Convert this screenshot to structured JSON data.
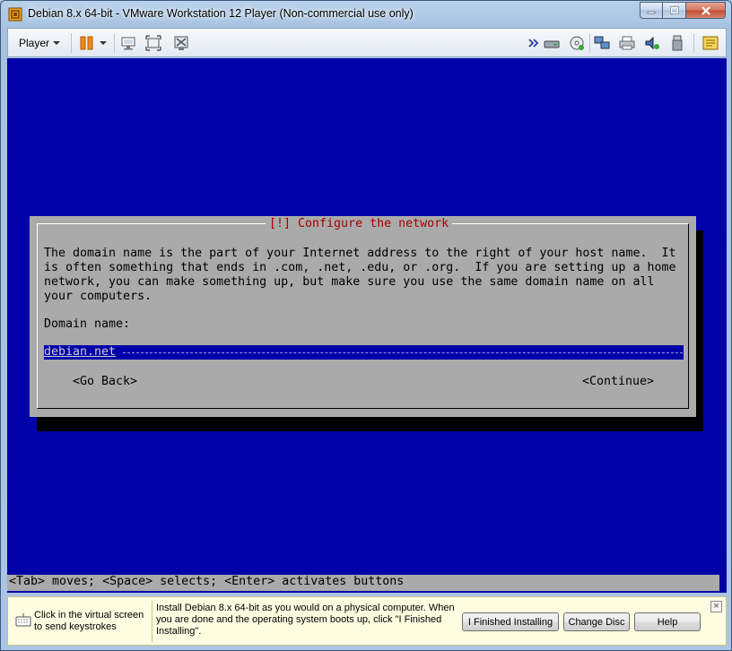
{
  "window": {
    "title": "Debian 8.x 64-bit - VMware Workstation 12 Player (Non-commercial use only)"
  },
  "toolbar": {
    "player_label": "Player"
  },
  "installer": {
    "dialog_title": "[!] Configure the network",
    "body_text": "The domain name is the part of your Internet address to the right of your host name.  It\nis often something that ends in .com, .net, .edu, or .org.  If you are setting up a home\nnetwork, you can make something up, but make sure you use the same domain name on all\nyour computers.",
    "domain_label": "Domain name:",
    "domain_value": "debian.net",
    "go_back_label": "<Go Back>",
    "continue_label": "<Continue>",
    "status_line": "<Tab> moves; <Space> selects; <Enter> activates buttons"
  },
  "hint_bar": {
    "click_hint": "Click in the virtual screen to send keystrokes",
    "install_hint": "Install Debian 8.x 64-bit as you would on a physical computer. When you are done and the operating system boots up, click \"I Finished Installing\".",
    "finished_label": "I Finished Installing",
    "change_disc_label": "Change Disc",
    "help_label": "Help"
  },
  "colors": {
    "vm_background": "#0202a8",
    "dialog_gray": "#aaaaaa",
    "dialog_title_red": "#a80000",
    "pause_orange": "#f08a1c"
  }
}
